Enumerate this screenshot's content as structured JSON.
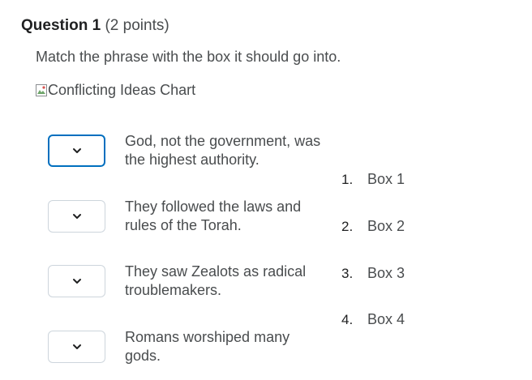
{
  "question": {
    "title": "Question 1",
    "points": "(2 points)",
    "prompt": "Match the phrase with the box it should go into.",
    "image_alt": "Conflicting Ideas Chart"
  },
  "match_items": [
    {
      "phrase": "God, not the government, was the highest authority.",
      "selected": ""
    },
    {
      "phrase": "They followed the laws and rules of the Torah.",
      "selected": ""
    },
    {
      "phrase": "They saw Zealots as radical troublemakers.",
      "selected": ""
    },
    {
      "phrase": "Romans worshiped many gods.",
      "selected": ""
    }
  ],
  "answers": [
    {
      "number": "1.",
      "label": "Box 1"
    },
    {
      "number": "2.",
      "label": "Box 2"
    },
    {
      "number": "3.",
      "label": "Box 3"
    },
    {
      "number": "4.",
      "label": "Box 4"
    }
  ],
  "icons": {
    "broken_image": "broken-image-icon",
    "dropdown": "chevron-down-icon"
  },
  "colors": {
    "focus_border": "#006fbf",
    "select_border": "#cdd5dc",
    "text": "#494c4e",
    "heading": "#202122"
  }
}
